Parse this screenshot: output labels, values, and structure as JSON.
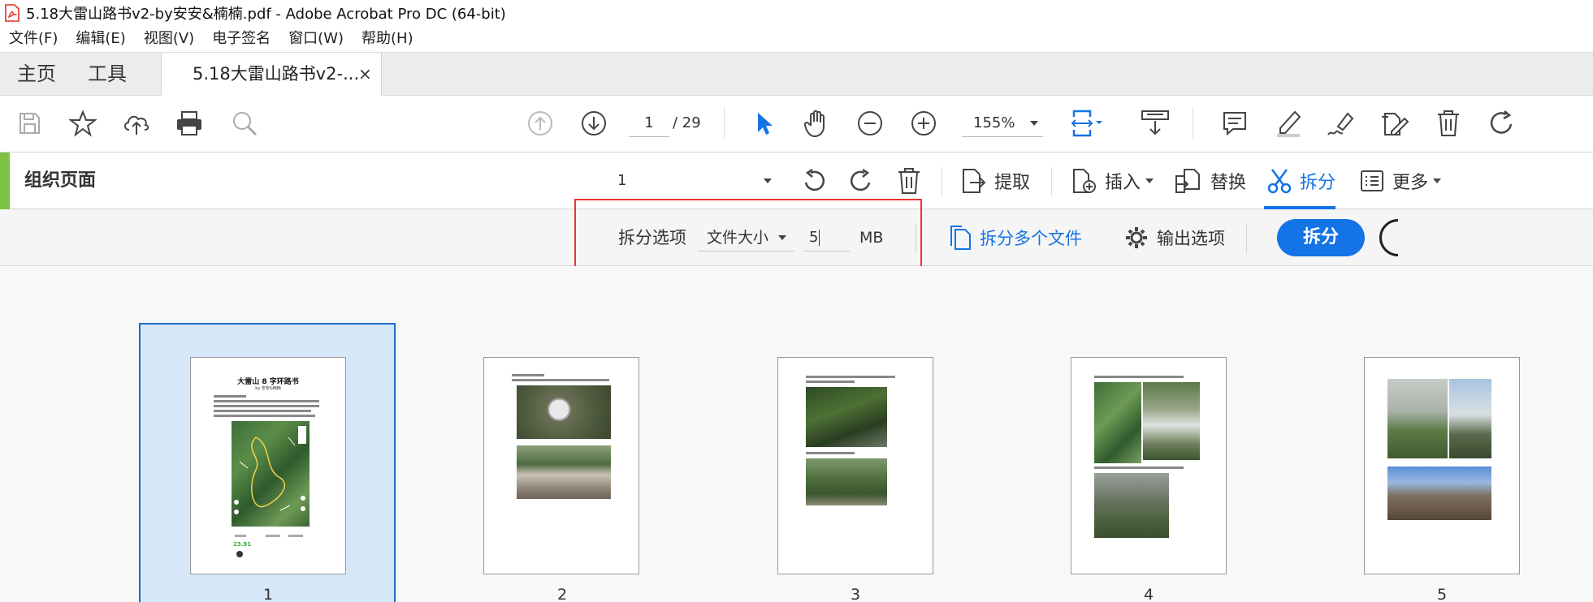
{
  "window": {
    "title": "5.18大雷山路书v2-by安安&楠楠.pdf - Adobe Acrobat Pro DC (64-bit)"
  },
  "menu": [
    "文件(F)",
    "编辑(E)",
    "视图(V)",
    "电子签名",
    "窗口(W)",
    "帮助(H)"
  ],
  "tabs": {
    "home": "主页",
    "tools": "工具",
    "document": "5.18大雷山路书v2-...",
    "close": "×"
  },
  "toolbar": {
    "page_current": "1",
    "page_total": "/ 29",
    "zoom": "155%"
  },
  "organize": {
    "title": "组织页面",
    "page_range": "1",
    "extract": "提取",
    "insert": "插入",
    "replace": "替换",
    "split": "拆分",
    "more": "更多"
  },
  "split_options": {
    "label": "拆分选项",
    "mode": "文件大小",
    "size_value": "5",
    "unit": "MB",
    "split_multiple": "拆分多个文件",
    "output_options": "输出选项",
    "split_button": "拆分"
  },
  "thumbnails": [
    {
      "number": "1",
      "title": "大雷山 8 字环路书",
      "subtitle": "by 安安&楠楠",
      "stat": "23.91",
      "selected": true
    },
    {
      "number": "2",
      "selected": false
    },
    {
      "number": "3",
      "selected": false
    },
    {
      "number": "4",
      "selected": false
    },
    {
      "number": "5",
      "selected": false
    }
  ],
  "colors": {
    "accent_blue": "#1473e6",
    "org_green": "#7dc242",
    "highlight_red": "#e33333",
    "selected_bg": "#d6e8f8"
  }
}
